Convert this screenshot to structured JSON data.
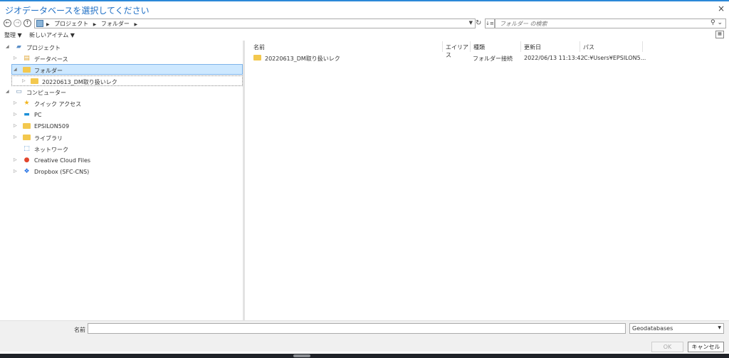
{
  "window": {
    "title": "ジオデータベースを選択してください",
    "close_label": "×"
  },
  "address_bar": {
    "breadcrumbs": [
      "プロジェクト",
      "フォルダー"
    ],
    "search_placeholder": "フォルダー の検索"
  },
  "toolbar": {
    "organize_label": "整理 ▼",
    "new_item_label": "新しいアイテム ▼"
  },
  "tree": {
    "project": "プロジェクト",
    "database": "データベース",
    "folder": "フォルダー",
    "sub_folder": "20220613_DM取り扱いレク",
    "computer": "コンピューター",
    "quick_access": "クイック アクセス",
    "pc": "PC",
    "epsilon": "EPSILON509",
    "library": "ライブラリ",
    "network": "ネットワーク",
    "creative_cloud": "Creative Cloud Files",
    "dropbox": "Dropbox (SFC-CNS)"
  },
  "list": {
    "columns": {
      "name": "名前",
      "alias": "エイリアス",
      "type": "種類",
      "modified": "更新日",
      "path": "パス"
    },
    "rows": [
      {
        "name": "20220613_DM取り扱いレク",
        "alias": "",
        "type": "フォルダー接続",
        "modified": "2022/06/13 11:13:42",
        "path": "C:¥Users¥EPSILON5..."
      }
    ]
  },
  "bottom": {
    "name_label": "名前",
    "name_value": "",
    "filter_value": "Geodatabases",
    "ok_label": "OK",
    "cancel_label": "キャンセル"
  },
  "colors": {
    "title": "#1f6fc5",
    "selection": "#cde8ff",
    "folder": "#f3c84e"
  }
}
